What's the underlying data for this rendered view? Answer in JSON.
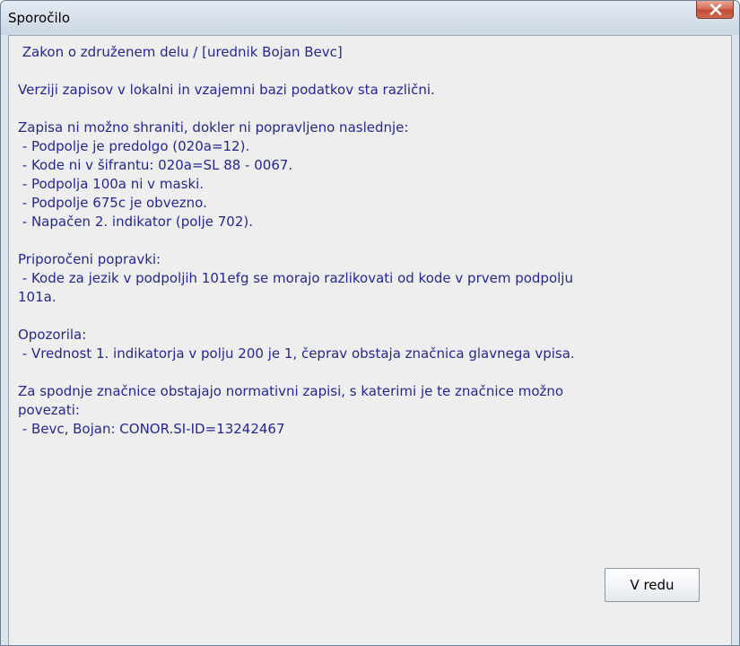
{
  "dialog": {
    "title": "Sporočilo",
    "ok_label": "V redu"
  },
  "message": {
    "lines": [
      " Zakon o združenem delu / [urednik Bojan Bevc]",
      "",
      "Verziji zapisov v lokalni in vzajemni bazi podatkov sta različni.",
      "",
      "Zapisa ni možno shraniti, dokler ni popravljeno naslednje:",
      " - Podpolje je predolgo (020a=12).",
      " - Kode ni v šifrantu: 020a=SL 88 - 0067.",
      " - Podpolja 100a ni v maski.",
      " - Podpolje 675c je obvezno.",
      " - Napačen 2. indikator (polje 702).",
      "",
      "Priporočeni popravki:",
      " - Kode za jezik v podpoljih 101efg se morajo razlikovati od kode v prvem podpolju",
      "101a.",
      "",
      "Opozorila:",
      " - Vrednost 1. indikatorja v polju 200 je 1, čeprav obstaja značnica glavnega vpisa.",
      "",
      "Za spodnje značnice obstajajo normativni zapisi, s katerimi je te značnice možno",
      "povezati:",
      " - Bevc, Bojan: CONOR.SI-ID=13242467"
    ]
  },
  "colors": {
    "message_text": "#26269a",
    "close_button": "#c24a33",
    "client_background": "#eeeeee"
  },
  "icons": {
    "close": "close-icon"
  }
}
